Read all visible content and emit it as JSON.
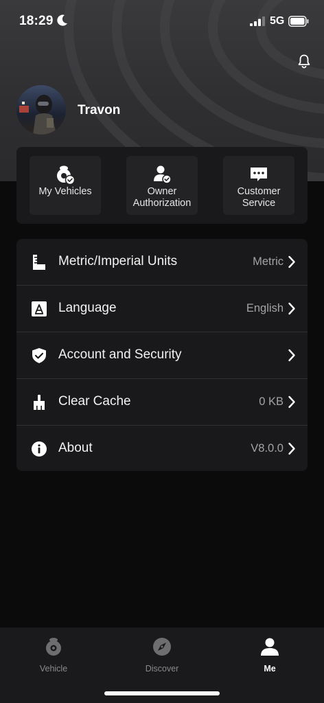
{
  "status_bar": {
    "time": "18:29",
    "network": "5G"
  },
  "profile": {
    "name": "Travon"
  },
  "shortcuts": [
    {
      "label": "My Vehicles",
      "icon": "vehicle-check-icon"
    },
    {
      "label": "Owner\nAuthorization",
      "icon": "owner-authorization-icon"
    },
    {
      "label": "Customer\nService",
      "icon": "customer-service-icon"
    }
  ],
  "settings": [
    {
      "label": "Metric/Imperial Units",
      "value": "Metric",
      "icon": "ruler-icon"
    },
    {
      "label": "Language",
      "value": "English",
      "icon": "language-icon"
    },
    {
      "label": "Account and Security",
      "value": "",
      "icon": "shield-check-icon"
    },
    {
      "label": "Clear Cache",
      "value": "0 KB",
      "icon": "broom-icon"
    },
    {
      "label": "About",
      "value": "V8.0.0",
      "icon": "info-icon"
    }
  ],
  "tabs": [
    {
      "label": "Vehicle",
      "icon": "vehicle-icon",
      "active": false
    },
    {
      "label": "Discover",
      "icon": "compass-icon",
      "active": false
    },
    {
      "label": "Me",
      "icon": "person-icon",
      "active": true
    }
  ],
  "colors": {
    "background": "#0b0b0c",
    "card": "#19191b",
    "tile": "#232325",
    "tab_bar": "#1a1a1c",
    "value_text": "#a3a3a6",
    "inactive_tab": "#8a8a8d"
  }
}
